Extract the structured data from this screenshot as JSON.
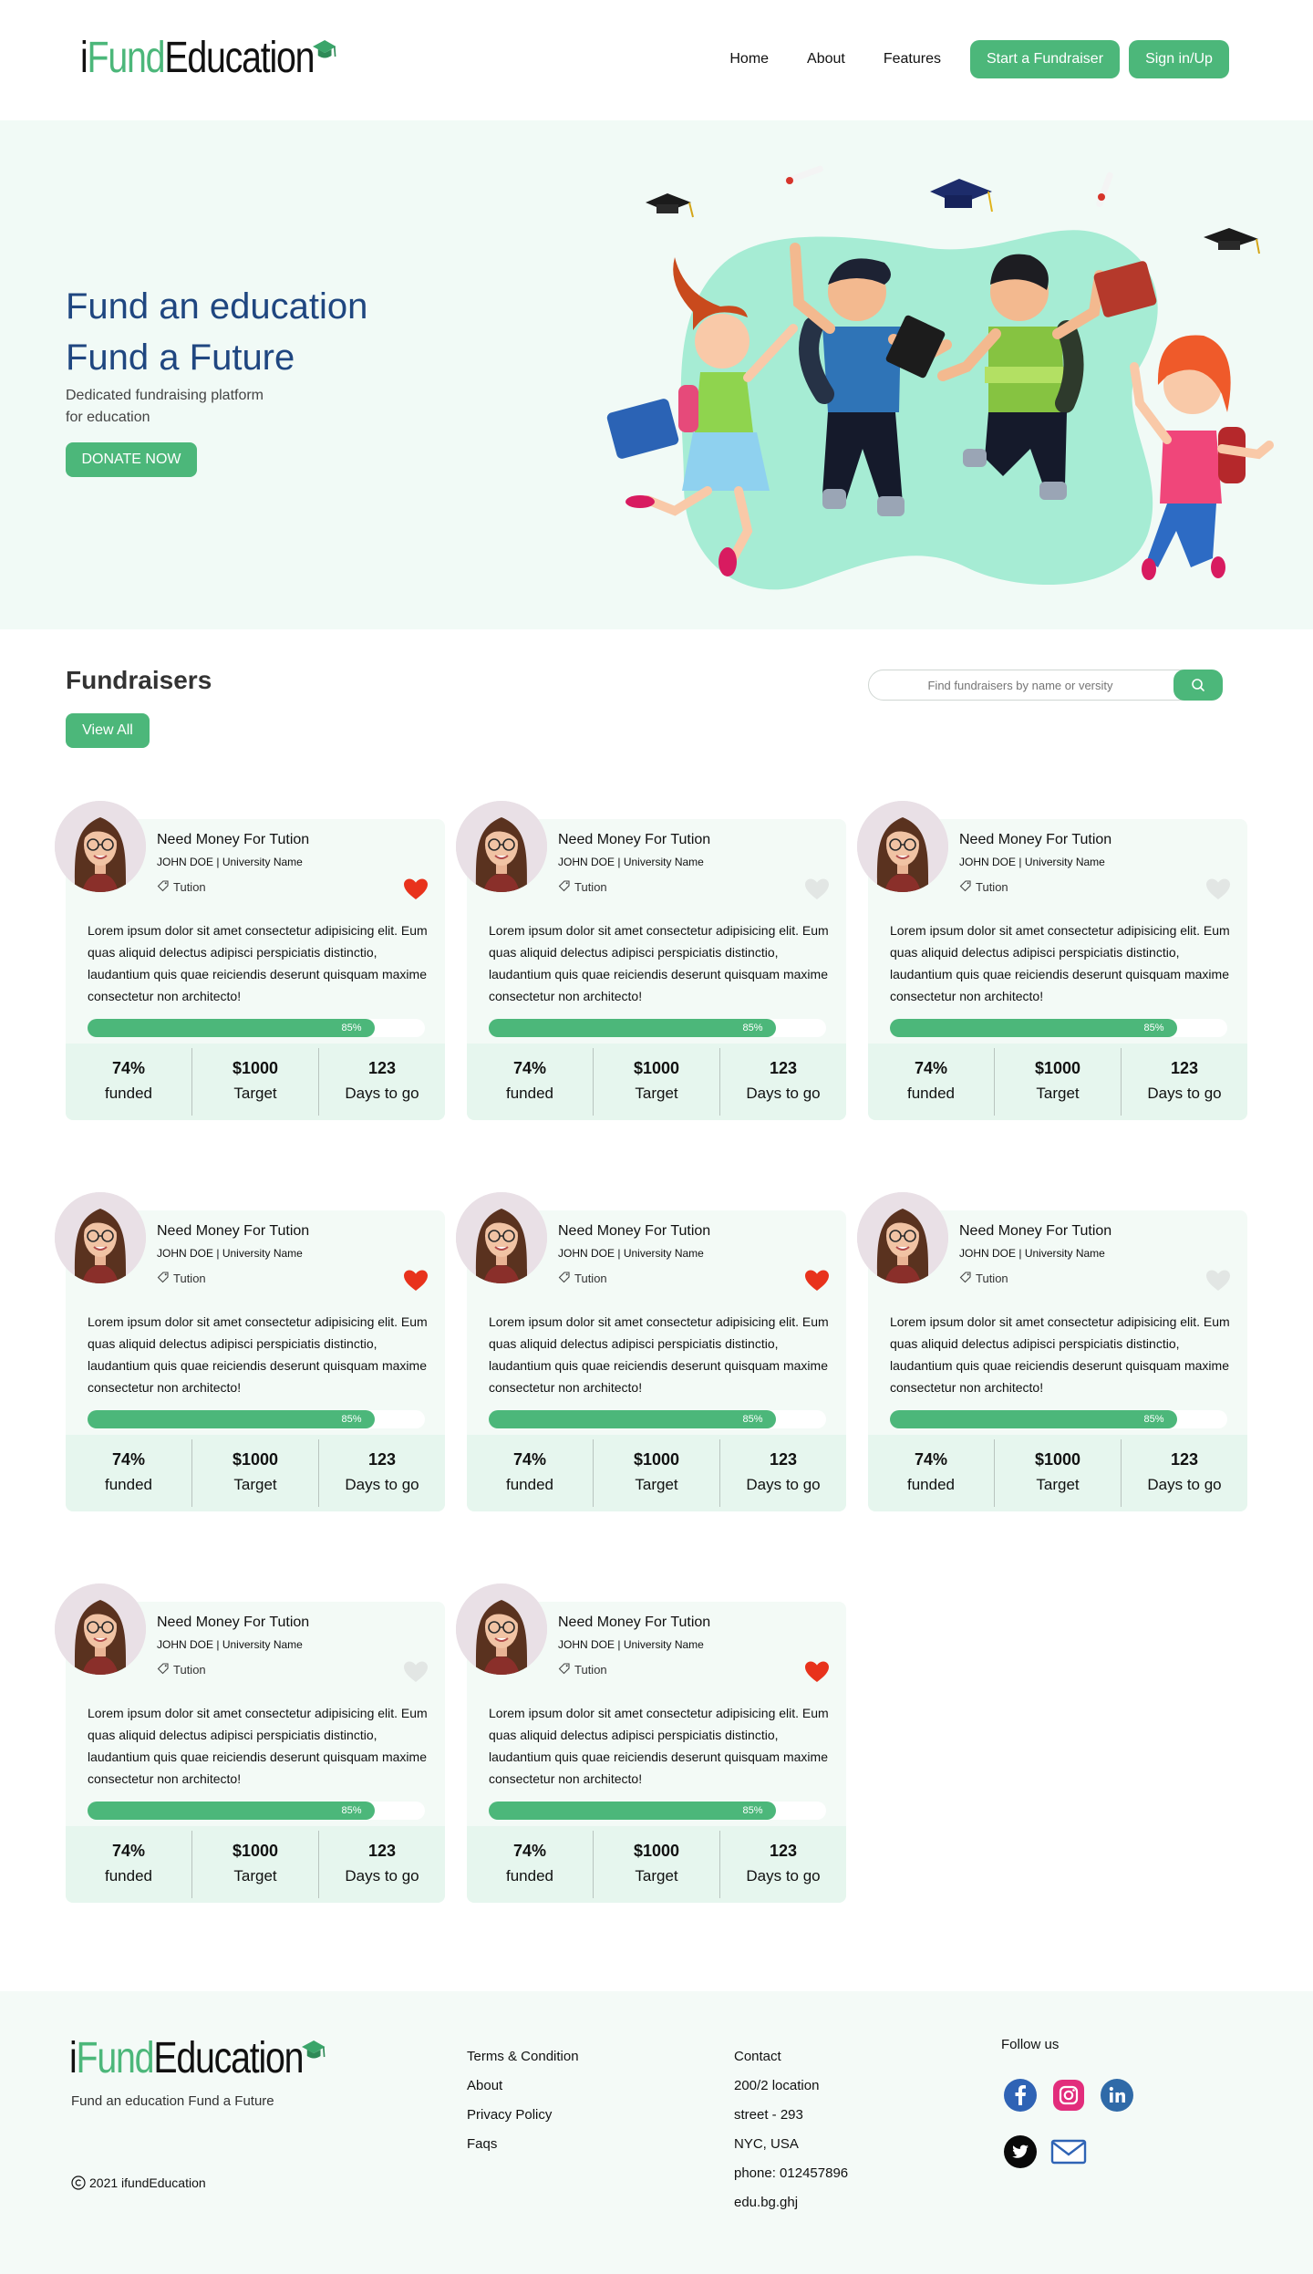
{
  "header": {
    "logo": {
      "part1": "i",
      "part2": "Fund",
      "part3": "Education"
    },
    "nav": [
      "Home",
      "About",
      "Features"
    ],
    "start_fundraiser": "Start a Fundraiser",
    "sign_in": "Sign in/Up"
  },
  "hero": {
    "title_line1": "Fund an education",
    "title_line2": "Fund a Future",
    "subtitle": "Dedicated fundraising platform for education",
    "donate": "DONATE NOW"
  },
  "fundraisers": {
    "title": "Fundraisers",
    "view_all": "View All",
    "search_placeholder": "Find fundraisers by name or versity",
    "cards": [
      {
        "title": "Need Money For Tution",
        "name": "JOHN DOE",
        "university": "University Name",
        "tag": "Tution",
        "liked": true,
        "desc": "Lorem ipsum dolor sit amet consectetur adipisicing elit. Eum quas aliquid delectus adipisci perspiciatis distinctio, laudantium quis quae reiciendis deserunt quisquam maxime consectetur non architecto!",
        "progress": 85,
        "progress_label": "85%",
        "funded": "74%",
        "funded_label": "funded",
        "target": "$1000",
        "target_label": "Target",
        "days": "123",
        "days_label": "Days to go"
      },
      {
        "title": "Need Money For Tution",
        "name": "JOHN DOE",
        "university": "University Name",
        "tag": "Tution",
        "liked": false,
        "desc": "Lorem ipsum dolor sit amet consectetur adipisicing elit. Eum quas aliquid delectus adipisci perspiciatis distinctio, laudantium quis quae reiciendis deserunt quisquam maxime consectetur non architecto!",
        "progress": 85,
        "progress_label": "85%",
        "funded": "74%",
        "funded_label": "funded",
        "target": "$1000",
        "target_label": "Target",
        "days": "123",
        "days_label": "Days to go"
      },
      {
        "title": "Need Money For Tution",
        "name": "JOHN DOE",
        "university": "University Name",
        "tag": "Tution",
        "liked": false,
        "desc": "Lorem ipsum dolor sit amet consectetur adipisicing elit. Eum quas aliquid delectus adipisci perspiciatis distinctio, laudantium quis quae reiciendis deserunt quisquam maxime consectetur non architecto!",
        "progress": 85,
        "progress_label": "85%",
        "funded": "74%",
        "funded_label": "funded",
        "target": "$1000",
        "target_label": "Target",
        "days": "123",
        "days_label": "Days to go"
      },
      {
        "title": "Need Money For Tution",
        "name": "JOHN DOE",
        "university": "University Name",
        "tag": "Tution",
        "liked": true,
        "desc": "Lorem ipsum dolor sit amet consectetur adipisicing elit. Eum quas aliquid delectus adipisci perspiciatis distinctio, laudantium quis quae reiciendis deserunt quisquam maxime consectetur non architecto!",
        "progress": 85,
        "progress_label": "85%",
        "funded": "74%",
        "funded_label": "funded",
        "target": "$1000",
        "target_label": "Target",
        "days": "123",
        "days_label": "Days to go"
      },
      {
        "title": "Need Money For Tution",
        "name": "JOHN DOE",
        "university": "University Name",
        "tag": "Tution",
        "liked": true,
        "desc": "Lorem ipsum dolor sit amet consectetur adipisicing elit. Eum quas aliquid delectus adipisci perspiciatis distinctio, laudantium quis quae reiciendis deserunt quisquam maxime consectetur non architecto!",
        "progress": 85,
        "progress_label": "85%",
        "funded": "74%",
        "funded_label": "funded",
        "target": "$1000",
        "target_label": "Target",
        "days": "123",
        "days_label": "Days to go"
      },
      {
        "title": "Need Money For Tution",
        "name": "JOHN DOE",
        "university": "University Name",
        "tag": "Tution",
        "liked": false,
        "desc": "Lorem ipsum dolor sit amet consectetur adipisicing elit. Eum quas aliquid delectus adipisci perspiciatis distinctio, laudantium quis quae reiciendis deserunt quisquam maxime consectetur non architecto!",
        "progress": 85,
        "progress_label": "85%",
        "funded": "74%",
        "funded_label": "funded",
        "target": "$1000",
        "target_label": "Target",
        "days": "123",
        "days_label": "Days to go"
      },
      {
        "title": "Need Money For Tution",
        "name": "JOHN DOE",
        "university": "University Name",
        "tag": "Tution",
        "liked": false,
        "desc": "Lorem ipsum dolor sit amet consectetur adipisicing elit. Eum quas aliquid delectus adipisci perspiciatis distinctio, laudantium quis quae reiciendis deserunt quisquam maxime consectetur non architecto!",
        "progress": 85,
        "progress_label": "85%",
        "funded": "74%",
        "funded_label": "funded",
        "target": "$1000",
        "target_label": "Target",
        "days": "123",
        "days_label": "Days to go"
      },
      {
        "title": "Need Money For Tution",
        "name": "JOHN DOE",
        "university": "University Name",
        "tag": "Tution",
        "liked": true,
        "desc": "Lorem ipsum dolor sit amet consectetur adipisicing elit. Eum quas aliquid delectus adipisci perspiciatis distinctio, laudantium quis quae reiciendis deserunt quisquam maxime consectetur non architecto!",
        "progress": 85,
        "progress_label": "85%",
        "funded": "74%",
        "funded_label": "funded",
        "target": "$1000",
        "target_label": "Target",
        "days": "123",
        "days_label": "Days to go"
      }
    ]
  },
  "footer": {
    "logo": {
      "part1": "i",
      "part2": "Fund",
      "part3": "Education"
    },
    "tagline": "Fund an education Fund a Future",
    "copyright": "2021 ifundEducation",
    "links": [
      "Terms & Condition",
      "About",
      "Privacy Policy",
      "Faqs"
    ],
    "contact": [
      "Contact",
      "200/2 location",
      "street - 293",
      "NYC, USA",
      "phone: 012457896",
      "edu.bg.ghj"
    ],
    "follow_us": "Follow us",
    "social": [
      "facebook-icon",
      "instagram-icon",
      "linkedin-icon",
      "twitter-icon",
      "mail-icon"
    ]
  },
  "colors": {
    "accent": "#4cb77a",
    "hero_title": "#1f4680",
    "hero_bg": "#f1faf6",
    "like": "#e8321c"
  }
}
